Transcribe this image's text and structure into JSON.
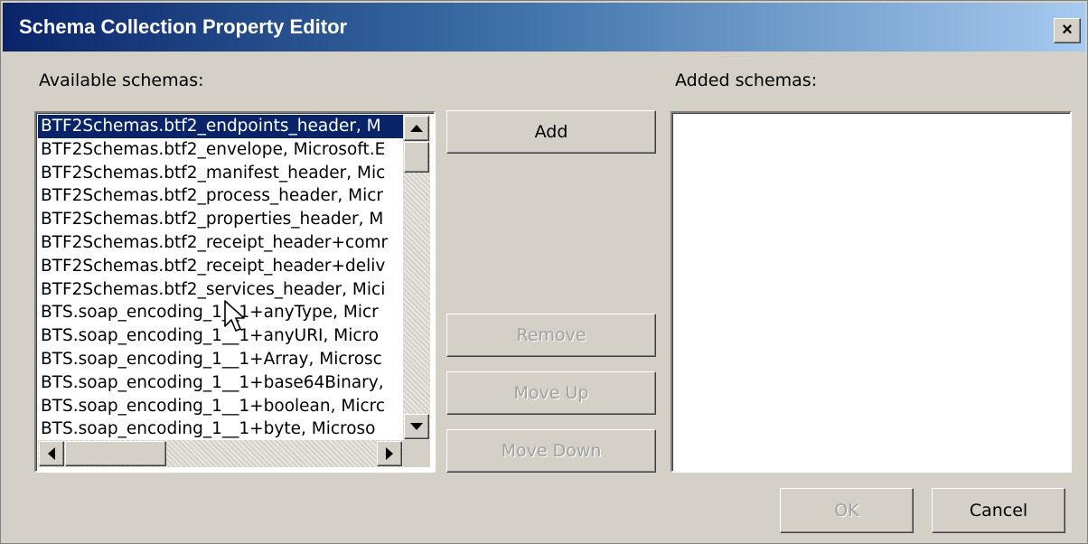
{
  "window": {
    "title": "Schema Collection Property Editor",
    "close_label": "×"
  },
  "labels": {
    "available": "Available schemas:",
    "added": "Added schemas:"
  },
  "available_schemas": [
    "BTF2Schemas.btf2_endpoints_header, M",
    "BTF2Schemas.btf2_envelope, Microsoft.E",
    "BTF2Schemas.btf2_manifest_header, Mic",
    "BTF2Schemas.btf2_process_header, Micr",
    "BTF2Schemas.btf2_properties_header, M",
    "BTF2Schemas.btf2_receipt_header+comr",
    "BTF2Schemas.btf2_receipt_header+deliv",
    "BTF2Schemas.btf2_services_header, Mici",
    "BTS.soap_encoding_1__1+anyType, Micr",
    "BTS.soap_encoding_1__1+anyURI, Micro",
    "BTS.soap_encoding_1__1+Array, Microsc",
    "BTS.soap_encoding_1__1+base64Binary,",
    "BTS.soap_encoding_1__1+boolean, Micrc",
    "BTS.soap_encoding_1__1+byte, Microso"
  ],
  "selected_index": 0,
  "added_schemas": [],
  "buttons": {
    "add": "Add",
    "remove": "Remove",
    "move_up": "Move Up",
    "move_down": "Move Down",
    "ok": "OK",
    "cancel": "Cancel"
  },
  "colors": {
    "title_gradient_start": "#0a246a",
    "title_gradient_end": "#a6caf0",
    "selection": "#0a246a",
    "dialog_bg": "#d4d0c8",
    "disabled_text": "#a0a0a0"
  }
}
